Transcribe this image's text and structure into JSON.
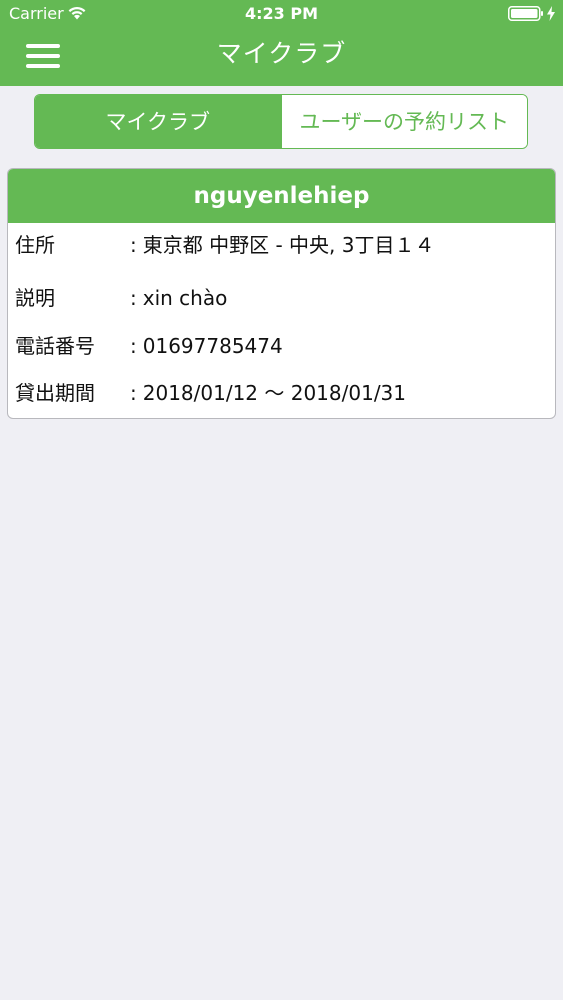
{
  "status_bar": {
    "carrier": "Carrier",
    "time": "4:23 PM"
  },
  "nav": {
    "title": "マイクラブ"
  },
  "segment": {
    "tabs": [
      {
        "label": "マイクラブ",
        "selected": true
      },
      {
        "label": "ユーザーの予約リスト",
        "selected": false
      }
    ]
  },
  "card": {
    "username": "nguyenlehiep",
    "rows": [
      {
        "label": "住所",
        "value": "東京都 中野区 - 中央, 3丁目１４"
      },
      {
        "label": "説明",
        "value": "xin chào"
      },
      {
        "label": "電話番号",
        "value": "01697785474"
      },
      {
        "label": "貸出期間",
        "value": "2018/01/12 ～ 2018/01/31"
      }
    ]
  },
  "colors": {
    "accent": "#64b954",
    "background": "#efeff4"
  }
}
